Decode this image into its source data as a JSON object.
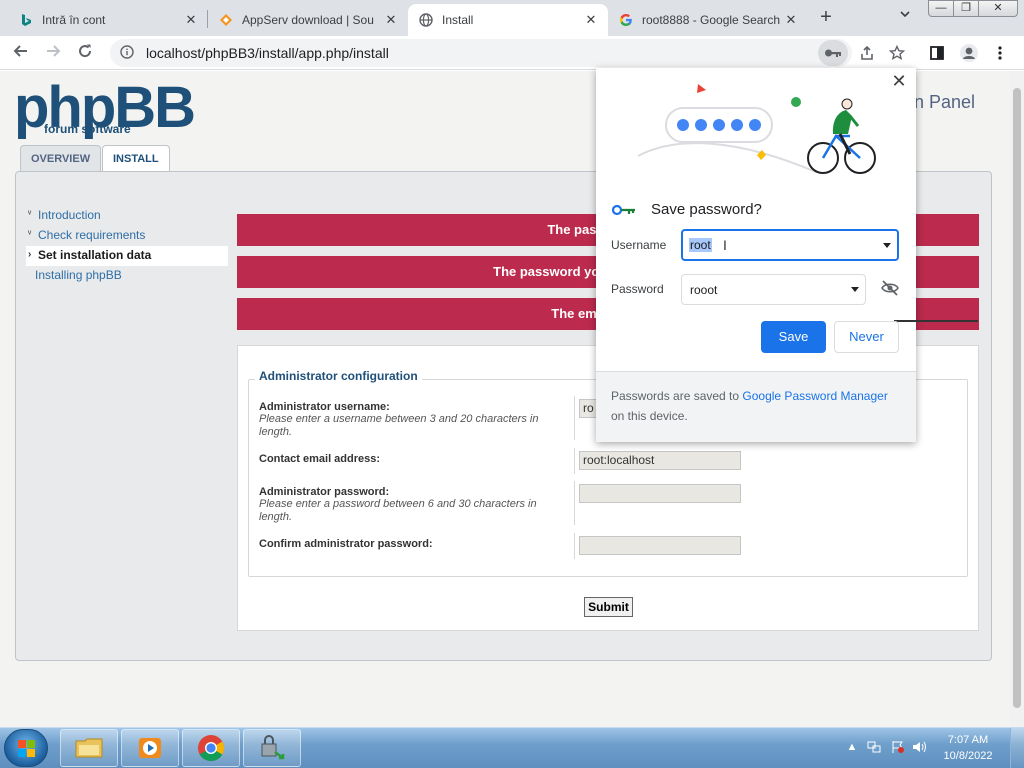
{
  "browser": {
    "tabs": [
      {
        "label": "Intră în cont",
        "icon": "bing-icon",
        "active": false
      },
      {
        "label": "AppServ download | Sou",
        "icon": "appserv-icon",
        "active": false
      },
      {
        "label": "Install",
        "icon": "globe-icon",
        "active": true
      },
      {
        "label": "root8888 - Google Search",
        "icon": "google-icon",
        "active": false
      }
    ],
    "url": "localhost/phpBB3/install/app.php/install"
  },
  "page": {
    "logo_text": "phpBB",
    "logo_sub": "forum software",
    "header_title_visible": "ion Panel",
    "tabs": [
      "OVERVIEW",
      "INSTALL"
    ],
    "menu": [
      {
        "label": "Introduction",
        "state": "done"
      },
      {
        "label": "Check requirements",
        "state": "done"
      },
      {
        "label": "Set installation data",
        "state": "active"
      },
      {
        "label": "Installing phpBB",
        "state": "pending"
      }
    ],
    "errors": [
      "The passwords you",
      "The password you entered is too sho",
      "The email address"
    ],
    "form": {
      "legend": "Administrator configuration",
      "fields": [
        {
          "label": "Administrator username:",
          "hint": "Please enter a username between 3 and 20 characters in length.",
          "value": "ro"
        },
        {
          "label": "Contact email address:",
          "hint": "",
          "value": "root:localhost"
        },
        {
          "label": "Administrator password:",
          "hint": "Please enter a password between 6 and 30 characters in length.",
          "value": ""
        },
        {
          "label": "Confirm administrator password:",
          "hint": "",
          "value": ""
        }
      ],
      "submit": "Submit"
    }
  },
  "password_popup": {
    "title": "Save password?",
    "username_label": "Username",
    "username_value": "root",
    "password_label": "Password",
    "password_value": "rooot",
    "save": "Save",
    "never": "Never",
    "footer_prefix": "Passwords are saved to ",
    "footer_link": "Google Password Manager",
    "footer_suffix": " on this device."
  },
  "taskbar": {
    "time": "7:07 AM",
    "date": "10/8/2022"
  },
  "colors": {
    "error_bar": "#bc2a4d",
    "chrome_blue": "#1a73e8",
    "phpbb_blue": "#1f5079"
  }
}
